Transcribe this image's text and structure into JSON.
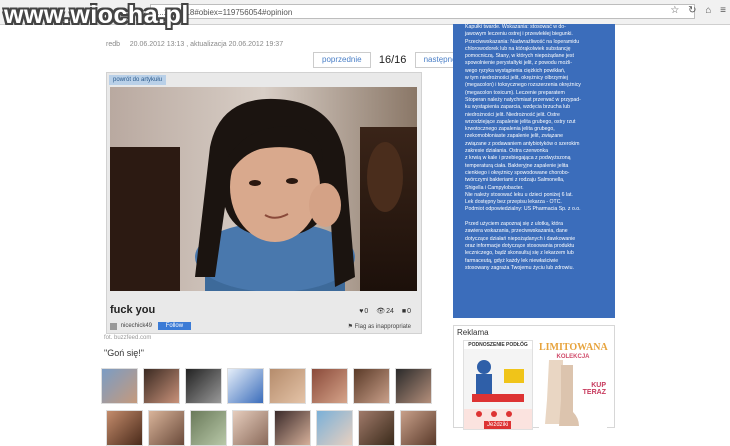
{
  "browser": {
    "address": "...158/v/18#obiex=119756054#opinion",
    "icons": [
      "star-icon",
      "refresh-icon",
      "home-icon",
      "settings-icon"
    ]
  },
  "watermark": "www.wiocha.pl",
  "article": {
    "author": "redb",
    "dates": "20.06.2012 13:13 , aktualizacja 20.06.2012 19:37",
    "pager": {
      "prev": "poprzednie",
      "count": "16/16",
      "next": "następne"
    },
    "back_link": "powrót do artykułu",
    "caption": "fuck you",
    "stats": {
      "likes": "0",
      "views": "24",
      "comments": "0"
    },
    "user": "nicechick49",
    "follow": "Follow",
    "flag": "Flag as inappropriate",
    "source": "fot. buzzfeed.com",
    "quote": "\"Goń się!\""
  },
  "sidebar_text": [
    "Kapułki twarde. Wskazania: stosować w do-",
    "jawowym leczeniu ostrej i przewlekłej biegunki.",
    "Przeciwwskazania: Nadwrażliwość na loperamidu",
    "chlorowodorek lub na którąkolwiek substancję",
    "pomocniczą. Stany, w których niepożądane jest",
    "spowolnienie perystaltyki jelit, z powodu możli-",
    "wego ryzyka wystąpienia ciężkich powikłań,",
    "w tym niedrożności jelit, okrężnicy olbrzymiej",
    "(megacolon) i toksycznego rozszerzenia okrężnicy",
    "(megacolon toxicum). Leczenie preparatem",
    "Stoperan należy natychmiast przerwać w przypad-",
    "ku wystąpienia zaparcia, wzdęcia brzucha lub",
    "niedrożności jelit. Niedrożność jelit. Ostre",
    "wrzodziejące zapalenie jelita grubego, ostry rzut",
    "krwotocznego zapalenia jelita grubego,",
    "rzekomobłoniaste zapalenie jelit, związane",
    "związane z podawaniem antybiotyków o szerokim",
    "zakresie działania. Ostra czerwonka",
    "z krwią w kale i przebiegająca z podwyższoną",
    "temperaturą ciała. Bakteryjne zapalenie jelita",
    "cienkiego i okrężnicy spowodowane chorobo-",
    "twórczymi bakteriami z rodzaju Salmonella,",
    "Shigella i Campylobacter.",
    "Nie należy stosować leku u dzieci poniżej 6 lat.",
    "Lek dostępny bez przepisu lekarza - OTC.",
    "Podmiot odpowiedzialny: US Pharmacia Sp. z o.o.",
    "",
    "Przed użyciem zapoznaj się z ulotką, która",
    "zawiera wskazania, przeciwwskazania, dane",
    "dotyczące działań niepożądanych i dawkowanie",
    "oraz informacje dotyczące stosowania produktu",
    "leczniczego, bądź skonsultuj się z lekarzem lub",
    "farmaceutą, gdyż każdy lek niewłaściwie",
    "stosowany zagraża Twojemu życiu lub zdrowiu."
  ],
  "ad": {
    "label": "Reklama",
    "ad1_title": "PODNOSZENIE PODŁÓG",
    "ad1_btn": "Jeździki",
    "ad2_title": "LIMITOWANA",
    "ad2_sub": "KOLEKCJA",
    "ad2_buy1": "KUP",
    "ad2_buy2": "TERAZ"
  },
  "colors": {
    "sidebar_bg": "#3b6dbb",
    "link": "#4a7fc7",
    "follow_bg": "#3b7bd6"
  }
}
